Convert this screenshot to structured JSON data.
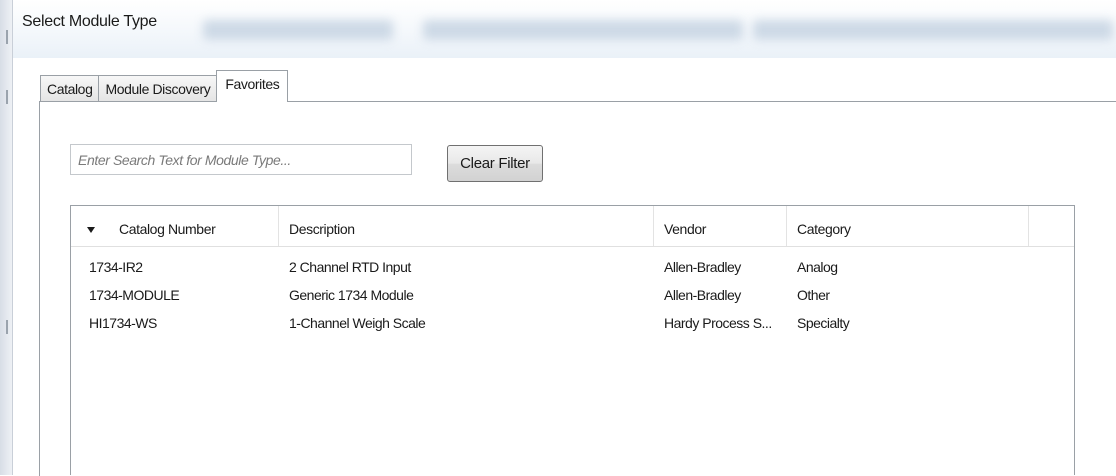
{
  "window": {
    "title": "Select Module Type"
  },
  "tabs": [
    {
      "label": "Catalog",
      "active": false
    },
    {
      "label": "Module Discovery",
      "active": false
    },
    {
      "label": "Favorites",
      "active": true
    }
  ],
  "search": {
    "placeholder": "Enter Search Text for Module Type...",
    "value": ""
  },
  "toolbar": {
    "clear_filter_label": "Clear Filter"
  },
  "table": {
    "sort_icon": "sort-descending-icon",
    "columns": [
      "Catalog Number",
      "Description",
      "Vendor",
      "Category"
    ],
    "rows": [
      {
        "catalog": "1734-IR2",
        "description": "2 Channel RTD Input",
        "vendor": "Allen-Bradley",
        "category": "Analog"
      },
      {
        "catalog": "1734-MODULE",
        "description": "Generic 1734 Module",
        "vendor": "Allen-Bradley",
        "category": "Other"
      },
      {
        "catalog": "HI1734-WS",
        "description": "1-Channel Weigh Scale",
        "vendor": "Hardy Process S...",
        "category": "Specialty"
      }
    ]
  }
}
